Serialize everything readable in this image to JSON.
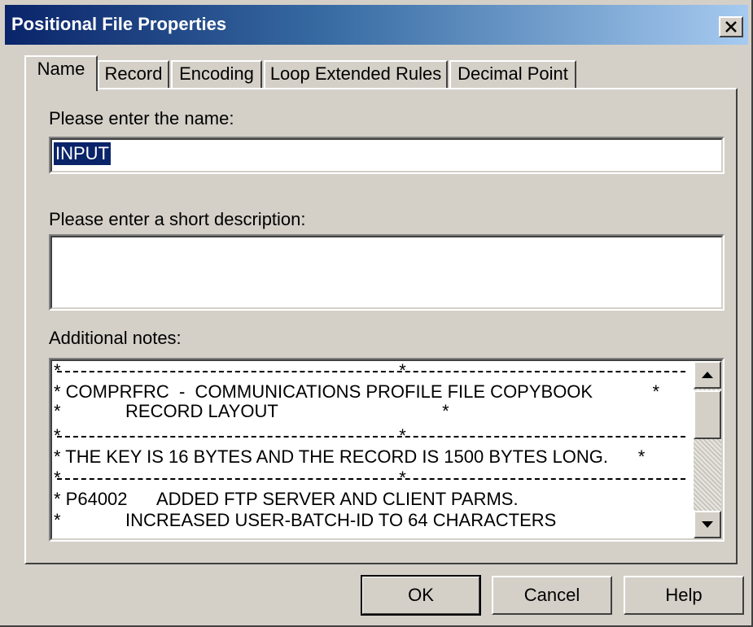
{
  "window": {
    "title": "Positional File Properties",
    "close_glyph": "✕"
  },
  "tabs": [
    {
      "label": "Name",
      "active": true
    },
    {
      "label": "Record",
      "active": false
    },
    {
      "label": "Encoding",
      "active": false
    },
    {
      "label": "Loop Extended Rules",
      "active": false
    },
    {
      "label": "Decimal Point",
      "active": false
    }
  ],
  "name_tab": {
    "name_label": "Please enter the name:",
    "name_value": "INPUT",
    "description_label": "Please enter a short description:",
    "description_value": "",
    "notes_label": "Additional notes:",
    "notes_lines": [
      "*                                                                    *",
      "* COMPRFRC  -  COMMUNICATIONS PROFILE FILE COPYBOOK            *",
      "*             RECORD LAYOUT                                 *",
      "*                                                                    *",
      "* THE KEY IS 16 BYTES AND THE RECORD IS 1500 BYTES LONG.      *",
      "*                                                                    *",
      "* P64002      ADDED FTP SERVER AND CLIENT PARMS.",
      "*             INCREASED USER-BATCH-ID TO 64 CHARACTERS"
    ]
  },
  "buttons": {
    "ok": "OK",
    "cancel": "Cancel",
    "help": "Help"
  },
  "colors": {
    "titlebar_start": "#0a246a",
    "titlebar_end": "#a6caf0",
    "face": "#d4d0c8",
    "selection": "#0a246a"
  },
  "icons": {
    "close": "close-icon",
    "scroll_up": "triangle-up-icon",
    "scroll_down": "triangle-down-icon"
  }
}
